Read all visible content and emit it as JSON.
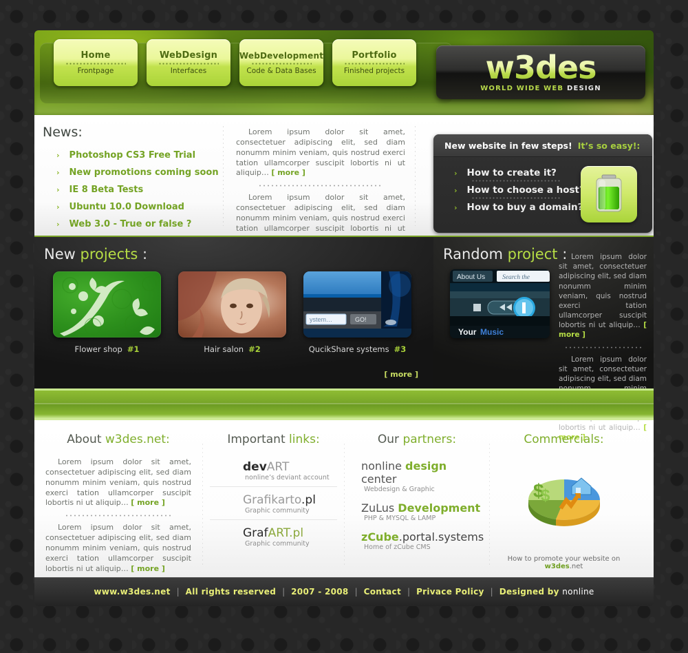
{
  "site": {
    "name": "w3des",
    "tagline_green": "WORLD WIDE WEB",
    "tagline_white": "DESIGN"
  },
  "nav": [
    {
      "title": "Home",
      "subtitle": "Frontpage"
    },
    {
      "title": "WebDesign",
      "subtitle": "Interfaces"
    },
    {
      "title": "WebDevelopment",
      "subtitle": "Code & Data Bases"
    },
    {
      "title": "Portfolio",
      "subtitle": "Finished projects"
    }
  ],
  "news": {
    "heading": "News:",
    "bullet": "›",
    "items": [
      "Photoshop CS3 Free Trial",
      "New promotions coming soon",
      "IE 8 Beta Tests",
      "Ubuntu 10.0 Download",
      "Web 3.0 - True or false ?"
    ]
  },
  "intro": {
    "p1": "Lorem ipsum dolor sit amet, consectetuer adipiscing elit, sed diam nonumm minim veniam, quis nostrud exerci tation ullamcorper suscipit lobortis ni ut aliquip… ",
    "p2": "Lorem ipsum dolor sit amet, consectetuer adipiscing elit, sed diam nonumm minim veniam, quis nostrud exerci tation ullamcorper suscipit lobortis ni ut aliquip… ",
    "more": "[ more ]"
  },
  "steps": {
    "title": "New website in few steps!",
    "title_accent": "It’s so easy!:",
    "bullet": "›",
    "items": [
      "How to create it?",
      "How to choose a host?",
      "How to buy a domain?"
    ],
    "icon": "battery-icon"
  },
  "projects": {
    "heading_plain": "New ",
    "heading_accent": "projects",
    "heading_colon": " :",
    "more": "[ more ]",
    "items": [
      {
        "name": "Flower shop",
        "num": "#1",
        "thumb": "flower-shop-thumbnail"
      },
      {
        "name": "Hair salon",
        "num": "#2",
        "thumb": "hair-salon-thumbnail"
      },
      {
        "name": "QucikShare systems",
        "num": "#3",
        "thumb": "quickshare-thumbnail"
      }
    ]
  },
  "random": {
    "heading_plain": "Random ",
    "heading_accent": "project",
    "heading_colon": " :",
    "thumb_labels": {
      "tab": "About Us",
      "search": "Search the",
      "brand_a": "Your",
      "brand_b": "Music"
    },
    "p1": "Lorem ipsum dolor sit amet, consectetuer adipiscing elit, sed diam nonumm minim veniam, quis nostrud exerci tation ullamcorper suscipit lobortis ni ut aliquip… ",
    "p2": "Lorem ipsum dolor sit amet, consectetuer adipiscing elit, sed diam nonumm minim veniam, quis nostrud exerci tation ullamcorper suscipit lobortis ni ut aliquip… ",
    "more": "[ more ]"
  },
  "footer": {
    "about": {
      "heading_plain": "About ",
      "heading_accent": "w3des.net:",
      "p1": "Lorem ipsum dolor sit amet, consectetuer adipiscing elit, sed diam nonumm minim veniam, quis nostrud exerci tation ullamcorper suscipit lobortis ni ut aliquip… ",
      "p2": "Lorem ipsum dolor sit amet, consectetuer adipiscing elit, sed diam nonumm minim veniam, quis nostrud exerci tation ullamcorper suscipit lobortis ni ut aliquip… ",
      "more": "[ more ]"
    },
    "links": {
      "heading_plain": "Important ",
      "heading_accent": "links:",
      "items": [
        {
          "t1": "dev",
          "t2": "ART",
          "sub": "nonline’s deviant account",
          "style": "dark-light"
        },
        {
          "t1": "Grafikarto",
          "t2": ".pl",
          "sub": "Graphic community",
          "style": "grey"
        },
        {
          "t1": "Graf",
          "t2": "ART.pl",
          "sub": "Graphic community",
          "style": "dark-accent"
        }
      ]
    },
    "partners": {
      "heading_plain": "Our ",
      "heading_accent": "partners:",
      "items": [
        {
          "a": "nonline ",
          "b": "design",
          "c": " center",
          "sub": "Webdesign & Graphic"
        },
        {
          "a": "ZuLus ",
          "b": "Development",
          "c": "",
          "sub": "PHP & MYSQL & LAMP"
        },
        {
          "a": "",
          "b": "zCube",
          "c": ".portal.systems",
          "sub": "Home of zCube CMS"
        }
      ]
    },
    "commercials": {
      "heading_plain": "",
      "heading_accent": "Commercials:",
      "icon": "pie-chart-icon",
      "note_plain_a": "How to promote your website on ",
      "note_brand": "w3des",
      "note_plain_b": ".net"
    }
  },
  "bottombar": {
    "items": [
      "www.w3des.net",
      "All rights reserved",
      "2007 - 2008",
      "Contact",
      "Privace Policy"
    ],
    "last_plain": "Designed by ",
    "last_white": "nonline",
    "separator": "|"
  },
  "colors": {
    "green": "#7fae2c",
    "lime": "#b6dd45",
    "yellow": "#e8ee77",
    "dark": "#242424"
  }
}
